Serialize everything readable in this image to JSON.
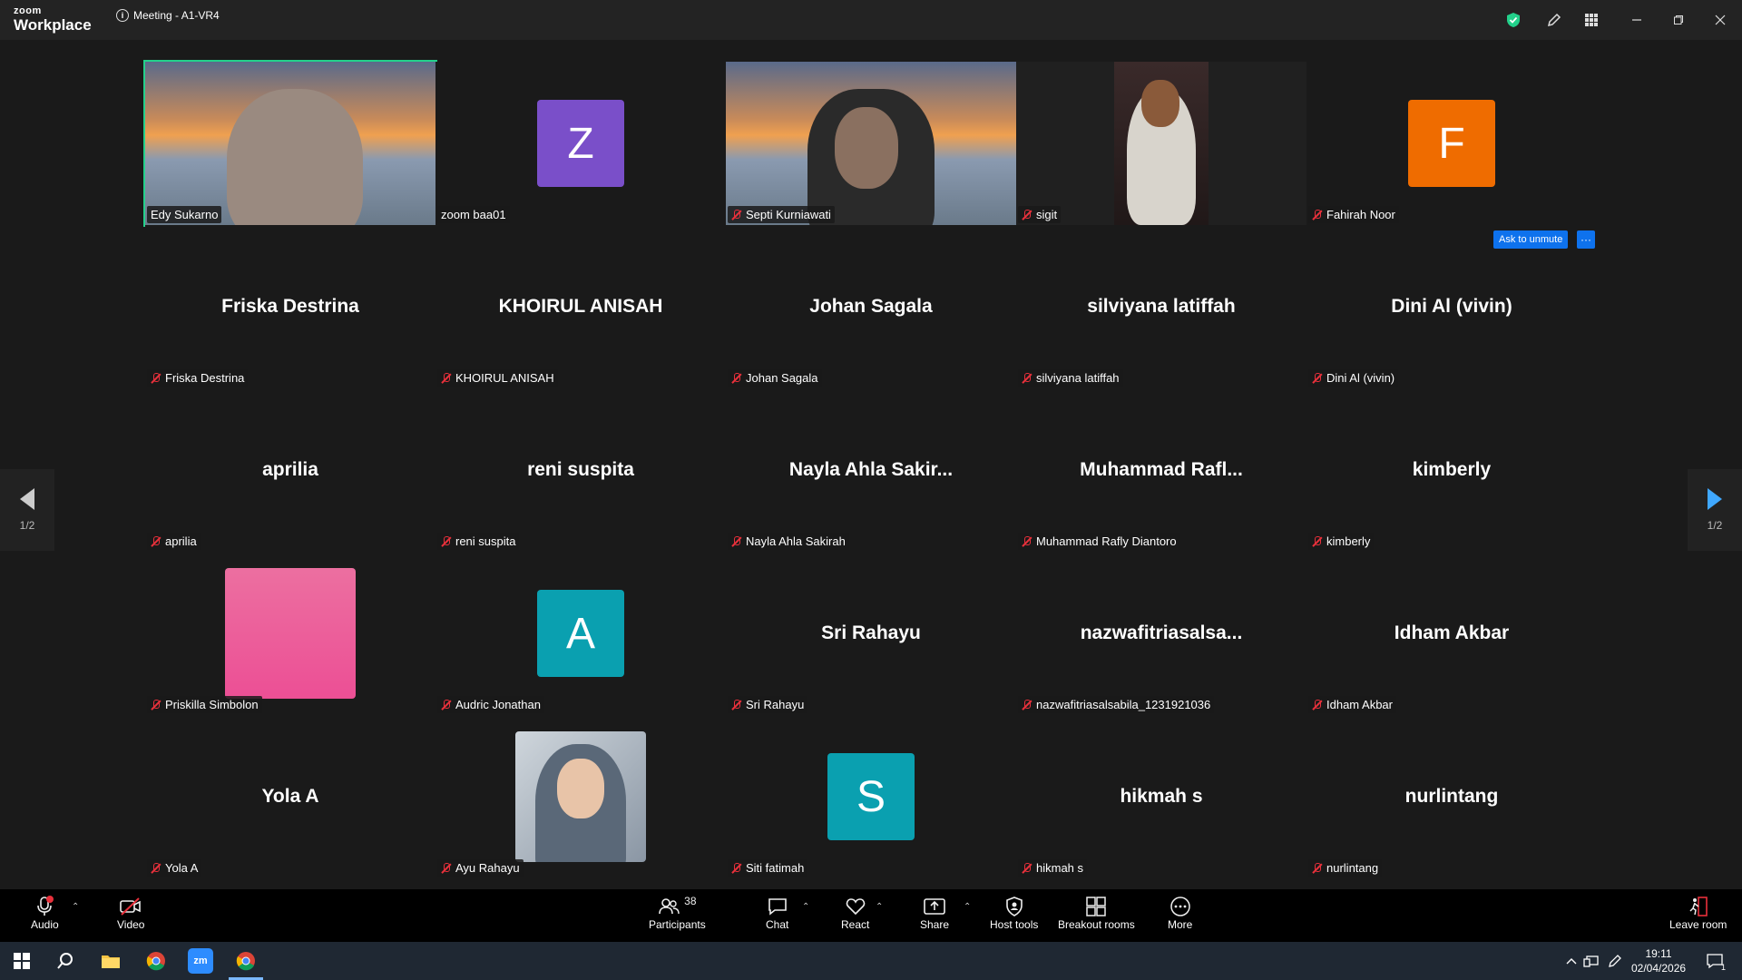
{
  "app": {
    "logo_small": "zoom",
    "logo_big": "Workplace",
    "meeting_title": "Meeting - A1-VR4"
  },
  "tiles": [
    {
      "label": "Edy Sukarno",
      "type": "video",
      "muted": false
    },
    {
      "label": "zoom baa01",
      "type": "avatar",
      "avatar_letter": "Z",
      "avatar_color": "#7a4fc9",
      "muted": false
    },
    {
      "label": "Septi Kurniawati",
      "type": "video",
      "muted": true
    },
    {
      "label": "sigit",
      "type": "video",
      "muted": true
    },
    {
      "label": "Fahirah Noor",
      "type": "avatar",
      "avatar_letter": "F",
      "avatar_color": "#ef6c00",
      "muted": true
    },
    {
      "label": "Friska Destrina",
      "display_name": "Friska Destrina",
      "type": "name",
      "muted": true
    },
    {
      "label": "KHOIRUL ANISAH",
      "display_name": "KHOIRUL ANISAH",
      "type": "name",
      "muted": true
    },
    {
      "label": "Johan Sagala",
      "display_name": "Johan Sagala",
      "type": "name",
      "muted": true
    },
    {
      "label": "silviyana latiffah",
      "display_name": "silviyana latiffah",
      "type": "name",
      "muted": true
    },
    {
      "label": "Dini Al (vivin)",
      "display_name": "Dini Al (vivin)",
      "type": "name",
      "muted": true
    },
    {
      "label": "aprilia",
      "display_name": "aprilia",
      "type": "name",
      "muted": true
    },
    {
      "label": "reni suspita",
      "display_name": "reni suspita",
      "type": "name",
      "muted": true
    },
    {
      "label": "Nayla Ahla Sakirah",
      "display_name": "Nayla  Ahla  Sakir...",
      "type": "name",
      "muted": true
    },
    {
      "label": "Muhammad Rafly Diantoro",
      "display_name": "Muhammad  Rafl...",
      "type": "name",
      "muted": true
    },
    {
      "label": "kimberly",
      "display_name": "kimberly",
      "type": "name",
      "muted": true
    },
    {
      "label": "Priskilla Simbolon",
      "type": "photo-pink",
      "muted": true
    },
    {
      "label": "Audric Jonathan",
      "type": "avatar",
      "avatar_letter": "A",
      "avatar_color": "#0aa0b0",
      "muted": true
    },
    {
      "label": "Sri Rahayu",
      "display_name": "Sri Rahayu",
      "type": "name",
      "muted": true
    },
    {
      "label": "nazwafitriasalsabila_1231921036",
      "display_name": "nazwafitriasalsa...",
      "type": "name",
      "muted": true
    },
    {
      "label": "Idham Akbar",
      "display_name": "Idham Akbar",
      "type": "name",
      "muted": true
    },
    {
      "label": "Yola A",
      "display_name": "Yola A",
      "type": "name",
      "muted": true
    },
    {
      "label": "Ayu Rahayu",
      "type": "photo",
      "muted": true
    },
    {
      "label": "Siti fatimah",
      "type": "avatar",
      "avatar_letter": "S",
      "avatar_color": "#0aa0b0",
      "muted": true
    },
    {
      "label": "hikmah s",
      "display_name": "hikmah s",
      "type": "name",
      "muted": true
    },
    {
      "label": "nurlintang",
      "display_name": "nurlintang",
      "type": "name",
      "muted": true
    }
  ],
  "ask_to_unmute": "Ask to unmute",
  "ask_more": "···",
  "pager": {
    "left_page": "1/2",
    "right_page": "1/2"
  },
  "toolbar": {
    "audio": "Audio",
    "video": "Video",
    "participants": "Participants",
    "participants_count": "38",
    "chat": "Chat",
    "react": "React",
    "share": "Share",
    "host_tools": "Host tools",
    "breakout_rooms": "Breakout rooms",
    "more": "More",
    "leave_room": "Leave room"
  },
  "taskbar": {
    "time": "19:11",
    "date": "02/04/2026",
    "notif_count": "1"
  },
  "colors": {
    "active_speaker": "#23d18b",
    "muted_red": "#e8303b",
    "blue": "#0e72ed"
  }
}
